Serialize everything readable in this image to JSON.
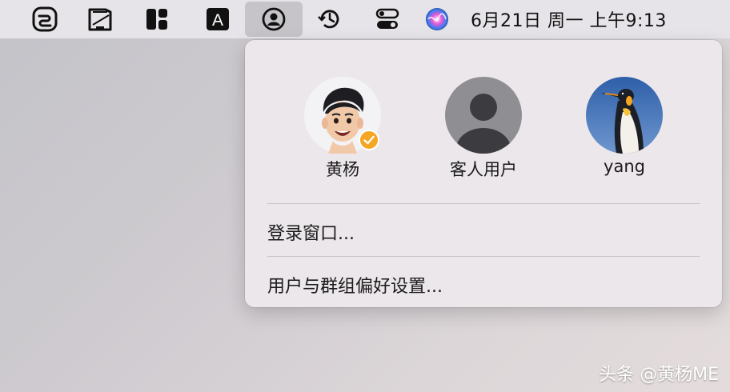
{
  "menubar": {
    "icons": [
      "link-app-icon",
      "tablet-app-icon",
      "layout-app-icon",
      "text-input-icon",
      "user-account-icon",
      "time-machine-icon",
      "control-center-icon",
      "siri-icon"
    ],
    "text_input_letter": "A",
    "clock": "6月21日 周一 上午9:13"
  },
  "users_menu": {
    "users": [
      {
        "name": "黄杨",
        "avatar": "memoji-avatar",
        "current": true
      },
      {
        "name": "客人用户",
        "avatar": "guest-avatar",
        "current": false
      },
      {
        "name": "yang",
        "avatar": "penguin-avatar",
        "current": false
      }
    ],
    "items": [
      {
        "label": "登录窗口..."
      },
      {
        "label": "用户与群组偏好设置..."
      }
    ]
  },
  "watermark": "头条 @黄杨ME",
  "colors": {
    "check_badge": "#f5a623",
    "menubar_bg": "#e6e4e8",
    "active_item_bg": "#c6c4c9"
  }
}
